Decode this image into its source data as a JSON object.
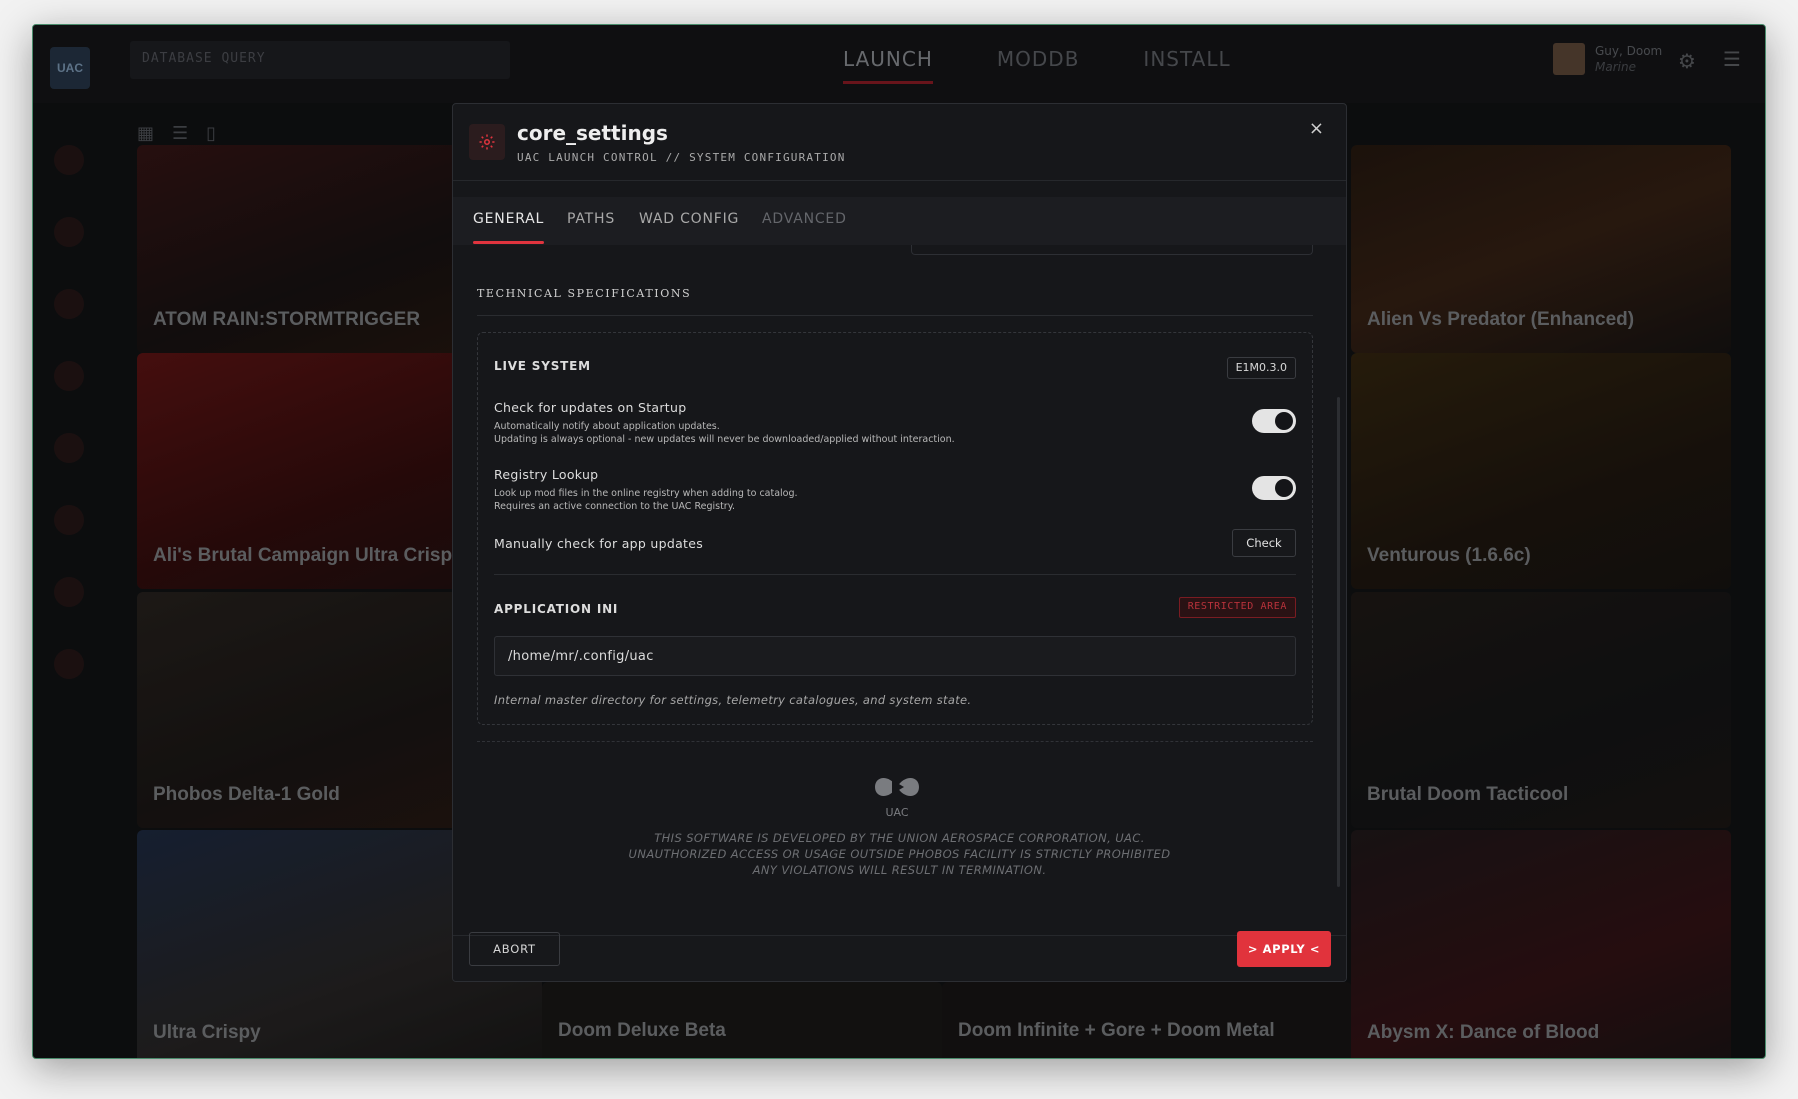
{
  "app": {
    "logo_text": "UAC",
    "search_placeholder": "DATABASE QUERY",
    "nav": [
      "LAUNCH",
      "MODDB",
      "INSTALL"
    ],
    "user": {
      "name": "Guy, Doom",
      "role": "Marine"
    },
    "cards": [
      {
        "title": "ATOM RAIN:STORMTRIGGER"
      },
      {
        "title": "Alien Vs Predator (Enhanced)"
      },
      {
        "title": "Ali's Brutal Campaign Ultra Crisp"
      },
      {
        "title": "Venturous (1.6.6c)"
      },
      {
        "title": "Phobos Delta-1 Gold"
      },
      {
        "title": "Brutal Doom Tacticool"
      },
      {
        "title": "Ultra Crispy"
      },
      {
        "title": "Doom Deluxe Beta"
      },
      {
        "title": "Doom Infinite + Gore + Doom Metal"
      },
      {
        "title": "Abysm X: Dance of Blood"
      }
    ]
  },
  "modal": {
    "title": "core_settings",
    "subtitle": "UAC LAUNCH CONTROL // SYSTEM CONFIGURATION",
    "close": "×",
    "tabs": [
      "GENERAL",
      "PATHS",
      "WAD CONFIG",
      "ADVANCED"
    ],
    "section_title": "TECHNICAL SPECIFICATIONS",
    "live_system": {
      "label": "LIVE SYSTEM",
      "version": "E1M0.3.0"
    },
    "check_updates": {
      "label": "Check for updates on Startup",
      "desc1": "Automatically notify about application updates.",
      "desc2": "Updating is always optional - new updates will never be downloaded/applied without interaction.",
      "enabled": true
    },
    "registry_lookup": {
      "label": "Registry Lookup",
      "desc1": "Look up mod files in the online registry when adding to catalog.",
      "desc2": "Requires an active connection to the UAC Registry.",
      "enabled": true
    },
    "manual_check": {
      "label": "Manually check for app updates",
      "button": "Check"
    },
    "app_ini": {
      "label": "APPLICATION INI",
      "badge": "RESTRICTED AREA",
      "path": "/home/mr/.config/uac",
      "hint": "Internal master directory for settings, telemetry catalogues, and system state."
    },
    "footer_logo": "UAC",
    "disclaimer": [
      "THIS SOFTWARE IS DEVELOPED BY THE UNION AEROSPACE CORPORATION, UAC.",
      "UNAUTHORIZED ACCESS OR USAGE OUTSIDE PHOBOS FACILITY IS STRICTLY PROHIBITED",
      "ANY VIOLATIONS WILL RESULT IN TERMINATION."
    ],
    "abort": "ABORT",
    "apply": "> APPLY <"
  },
  "colors": {
    "accent": "#e1333c",
    "background": "#131416",
    "modal": "#16171a",
    "border_green": "#4a8c6c"
  },
  "icons": [
    "gear-icon",
    "close-icon",
    "grid-view-icon",
    "list-view-icon",
    "book-view-icon",
    "hamburger-icon",
    "uac-logo"
  ]
}
